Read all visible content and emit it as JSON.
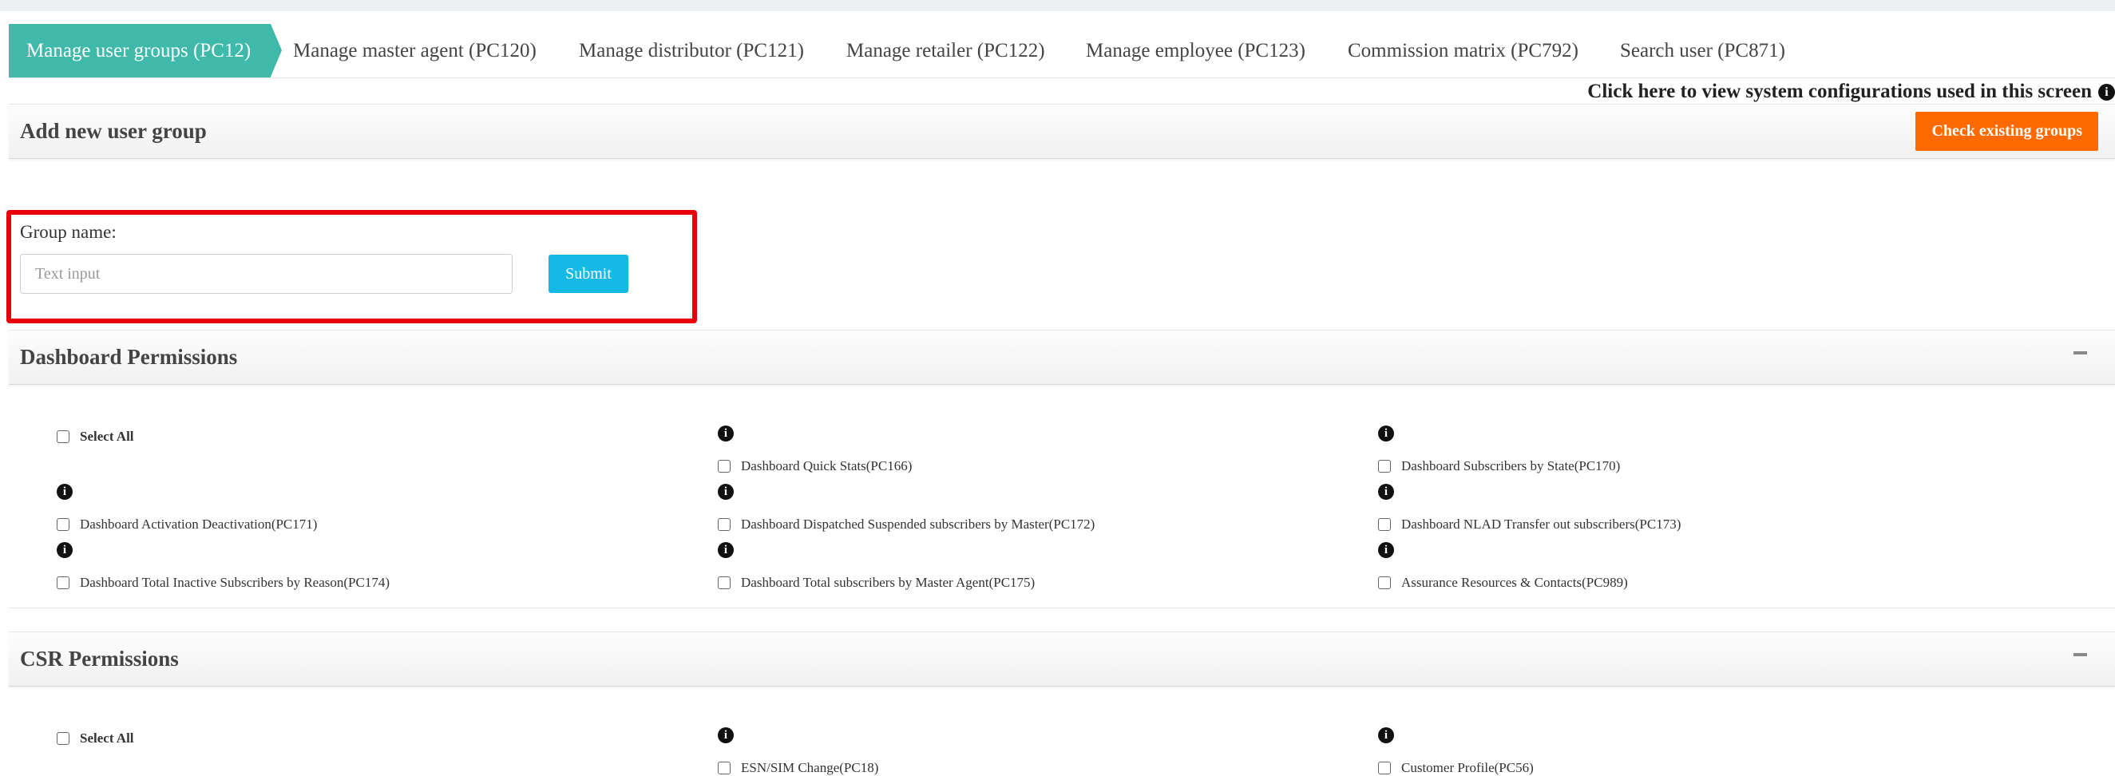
{
  "tabs": [
    {
      "label": "Manage user groups (PC12)",
      "active": true
    },
    {
      "label": "Manage master agent (PC120)"
    },
    {
      "label": "Manage distributor (PC121)"
    },
    {
      "label": "Manage retailer (PC122)"
    },
    {
      "label": "Manage employee (PC123)"
    },
    {
      "label": "Commission matrix (PC792)"
    },
    {
      "label": "Search user (PC871)"
    }
  ],
  "system_config_link": "Click here to view system configurations used in this screen",
  "add_group": {
    "title": "Add new user group",
    "check_button": "Check existing groups",
    "group_name_label": "Group name:",
    "group_name_placeholder": "Text input",
    "group_name_value": "",
    "submit_label": "Submit"
  },
  "dashboard_permissions": {
    "title": "Dashboard Permissions",
    "select_all": "Select All",
    "items": [
      "Dashboard Quick Stats(PC166)",
      "Dashboard Subscribers by State(PC170)",
      "Dashboard Activation Deactivation(PC171)",
      "Dashboard Dispatched Suspended subscribers by Master(PC172)",
      "Dashboard NLAD Transfer out subscribers(PC173)",
      "Dashboard Total Inactive Subscribers by Reason(PC174)",
      "Dashboard Total subscribers by Master Agent(PC175)",
      "Assurance Resources & Contacts(PC989)"
    ]
  },
  "csr_permissions": {
    "title": "CSR Permissions",
    "select_all": "Select All",
    "items": [
      "ESN/SIM Change(PC18)",
      "Customer Profile(PC56)"
    ]
  },
  "colors": {
    "active_tab": "#3fb9a9",
    "check_button": "#ff6a00",
    "submit_button": "#14b9e6",
    "highlight_border": "#e8000b"
  },
  "icons": {
    "info": "info-circle-icon",
    "collapse": "minus-icon"
  }
}
